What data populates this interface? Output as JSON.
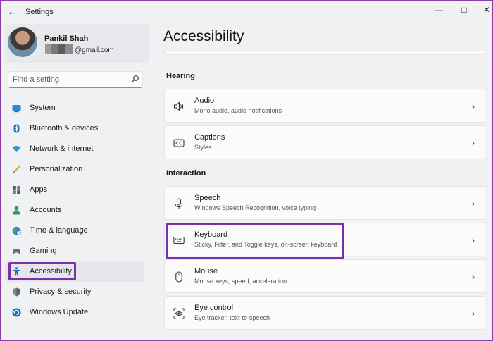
{
  "window": {
    "title": "Settings",
    "back_glyph": "←",
    "minimize_glyph": "—",
    "maximize_glyph": "□",
    "close_glyph": "✕"
  },
  "profile": {
    "name": "Pankil Shah",
    "email_visible": "@gmail.com"
  },
  "search": {
    "placeholder": "Find a setting",
    "icon": "search-icon"
  },
  "sidebar": {
    "items": [
      {
        "label": "System",
        "icon": "monitor-icon"
      },
      {
        "label": "Bluetooth & devices",
        "icon": "bluetooth-icon"
      },
      {
        "label": "Network & internet",
        "icon": "wifi-icon"
      },
      {
        "label": "Personalization",
        "icon": "brush-icon"
      },
      {
        "label": "Apps",
        "icon": "apps-grid-icon"
      },
      {
        "label": "Accounts",
        "icon": "person-icon"
      },
      {
        "label": "Time & language",
        "icon": "globe-clock-icon"
      },
      {
        "label": "Gaming",
        "icon": "gamepad-icon"
      },
      {
        "label": "Accessibility",
        "icon": "accessibility-icon",
        "selected": true
      },
      {
        "label": "Privacy & security",
        "icon": "shield-icon"
      },
      {
        "label": "Windows Update",
        "icon": "update-icon"
      }
    ]
  },
  "main": {
    "title": "Accessibility",
    "sections": [
      {
        "title": "Hearing",
        "cards": [
          {
            "title": "Audio",
            "subtitle": "Mono audio, audio notifications",
            "icon": "speaker-icon"
          },
          {
            "title": "Captions",
            "subtitle": "Styles",
            "icon": "cc-icon"
          }
        ]
      },
      {
        "title": "Interaction",
        "cards": [
          {
            "title": "Speech",
            "subtitle": "Windows Speech Recognition, voice typing",
            "icon": "microphone-icon"
          },
          {
            "title": "Keyboard",
            "subtitle": "Sticky, Filter, and Toggle keys, on-screen keyboard",
            "icon": "keyboard-icon",
            "highlighted": true
          },
          {
            "title": "Mouse",
            "subtitle": "Mouse keys, speed, acceleration",
            "icon": "mouse-icon"
          },
          {
            "title": "Eye control",
            "subtitle": "Eye tracker, text-to-speech",
            "icon": "eye-control-icon"
          }
        ]
      }
    ],
    "chevron_glyph": "›"
  },
  "colors": {
    "highlight_border": "#7e2ea8",
    "accent_blue": "#0067c0"
  }
}
